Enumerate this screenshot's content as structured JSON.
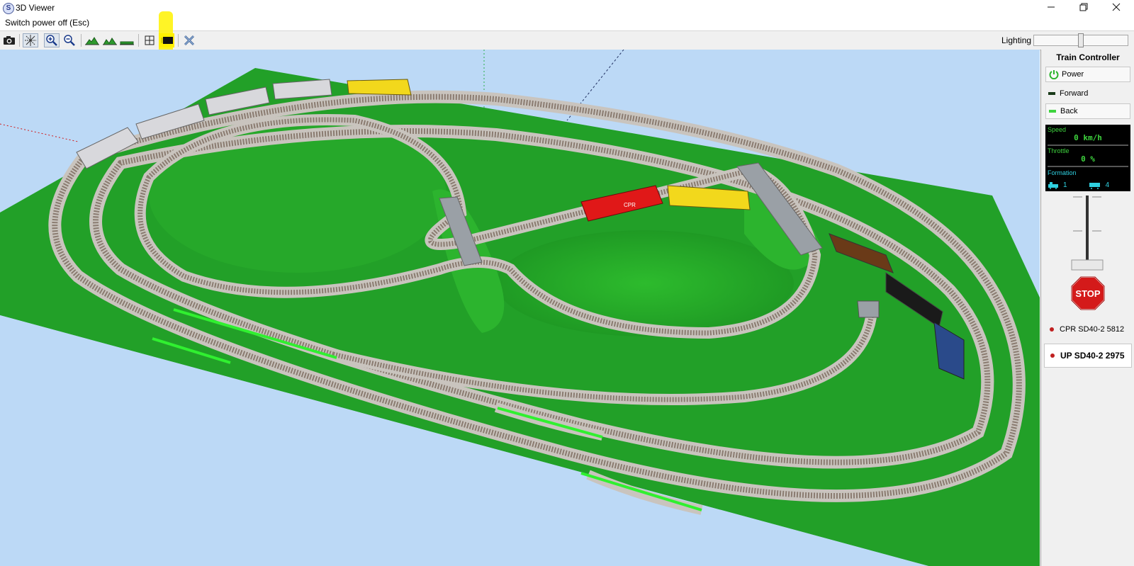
{
  "window": {
    "title": "3D Viewer",
    "icon": "app-s-icon",
    "controls": [
      "minimize-icon",
      "restore-icon",
      "close-icon"
    ]
  },
  "status": {
    "text": "Switch power off (Esc)"
  },
  "toolbar": {
    "buttons": [
      "camera-icon",
      "axes-icon",
      "zoom-in-icon",
      "zoom-out-icon",
      "terrain-icon",
      "mountains-icon",
      "flat-icon",
      "grid-icon",
      "video-camera-icon",
      "cross-icon"
    ],
    "lighting_label": "Lighting",
    "lighting_level": 0.5
  },
  "panel": {
    "title": "Train Controller",
    "power_label": "Power",
    "forward_label": "Forward",
    "back_label": "Back",
    "speed_label": "Speed",
    "speed_value": "0 km/h",
    "throttle_label": "Throttle",
    "throttle_value": "0 %",
    "formation_label": "Formation",
    "formation_locos": "1",
    "formation_cars": "4",
    "stop_label": "STOP",
    "locos": [
      {
        "name": "CPR SD40-2 5812",
        "selected": false
      },
      {
        "name": "UP SD40-2 2975",
        "selected": true
      }
    ]
  },
  "scene": {
    "labels": {
      "cpr_loco": "CPR"
    },
    "colors": {
      "sky": "#bcd9f6",
      "grass": "#22a028",
      "rail": "#9a8f86",
      "ballast": "#c9c4be",
      "cpr": "#e01818",
      "up": "#f2d81c",
      "highlight": "#fff200"
    }
  }
}
